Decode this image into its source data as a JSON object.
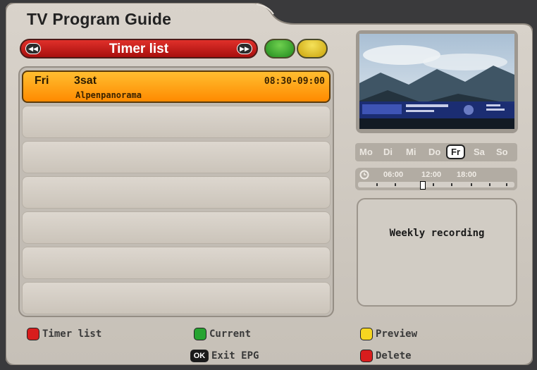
{
  "window": {
    "title": "TV Program Guide"
  },
  "header": {
    "title": "Timer list",
    "prev_icon": "rewind-icon",
    "next_icon": "fast-forward-icon"
  },
  "colors": {
    "header": "#c81c18",
    "selected_row": "#ffa21a",
    "green_key": "#27a431",
    "yellow_key": "#f6d621",
    "red_key": "#d81d1d"
  },
  "timers": [
    {
      "day": "Fri",
      "channel": "3sat",
      "time": "08:30-09:00",
      "program": "Alpenpanorama",
      "selected": true
    }
  ],
  "week": {
    "days": [
      "Mo",
      "Di",
      "Mi",
      "Do",
      "Fr",
      "Sa",
      "So"
    ],
    "active": "Fr"
  },
  "timeline": {
    "icon": "clock-icon",
    "labels": [
      "06:00",
      "12:00",
      "18:00"
    ]
  },
  "info": {
    "text": "Weekly recording"
  },
  "legend": {
    "red": "Timer list",
    "green": "Current",
    "yellow": "Preview",
    "ok_key": "OK",
    "ok": "Exit EPG",
    "delete": "Delete"
  }
}
